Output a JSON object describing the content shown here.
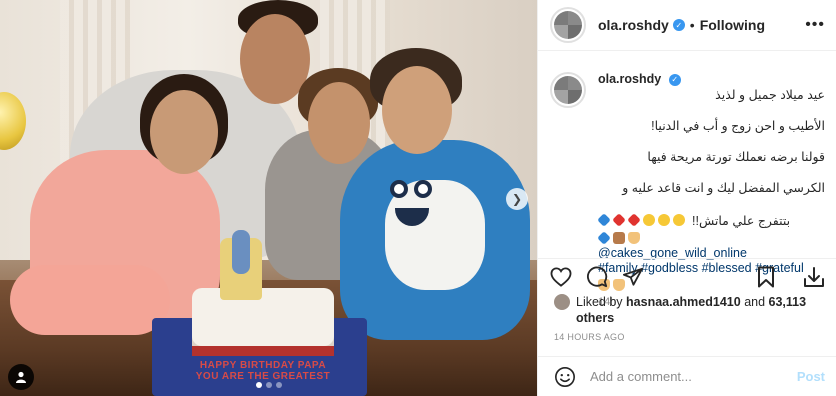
{
  "post": {
    "username": "ola.roshdy",
    "follow_status": "Following",
    "more_icon": "more-horizontal-icon",
    "verified_icon": "verified-badge-icon",
    "separator": "•"
  },
  "caption": {
    "username": "ola.roshdy",
    "lines": [
      "عيد ميلاد جميل و لذيذ",
      "الأطيب و احن زوج و أب في الدنيا!",
      "قولنا برضه نعملك تورتة مريحة فيها",
      "الكرسي المفضل ليك و انت قاعد عليه و",
      "بتتفرج علي ماتش!!"
    ],
    "mention": "@cakes_gone_wild_online",
    "hashtags": [
      "#family",
      "#godbless",
      "#blessed",
      "#grateful"
    ],
    "age": "14h"
  },
  "cake": {
    "text": "HAPPY BIRTHDAY PAPA YOU ARE THE GREATEST"
  },
  "likes": {
    "prefix": "Liked by",
    "user": "hasnaa.ahmed1410",
    "conjunction": "and",
    "others": "63,113 others"
  },
  "timestamp": "14 HOURS AGO",
  "comment_box": {
    "placeholder": "Add a comment...",
    "post_label": "Post"
  },
  "carousel": {
    "slide_count": 3,
    "active_index": 0
  },
  "colors": {
    "link": "#00376b",
    "verified": "#3897f0",
    "post_button": "#b2dffc",
    "muted": "#8e8e8e"
  },
  "icons": [
    "heart-icon",
    "comment-icon",
    "share-icon",
    "bookmark-icon",
    "download-icon",
    "smiley-icon",
    "chevron-right-icon",
    "user-tag-icon"
  ]
}
